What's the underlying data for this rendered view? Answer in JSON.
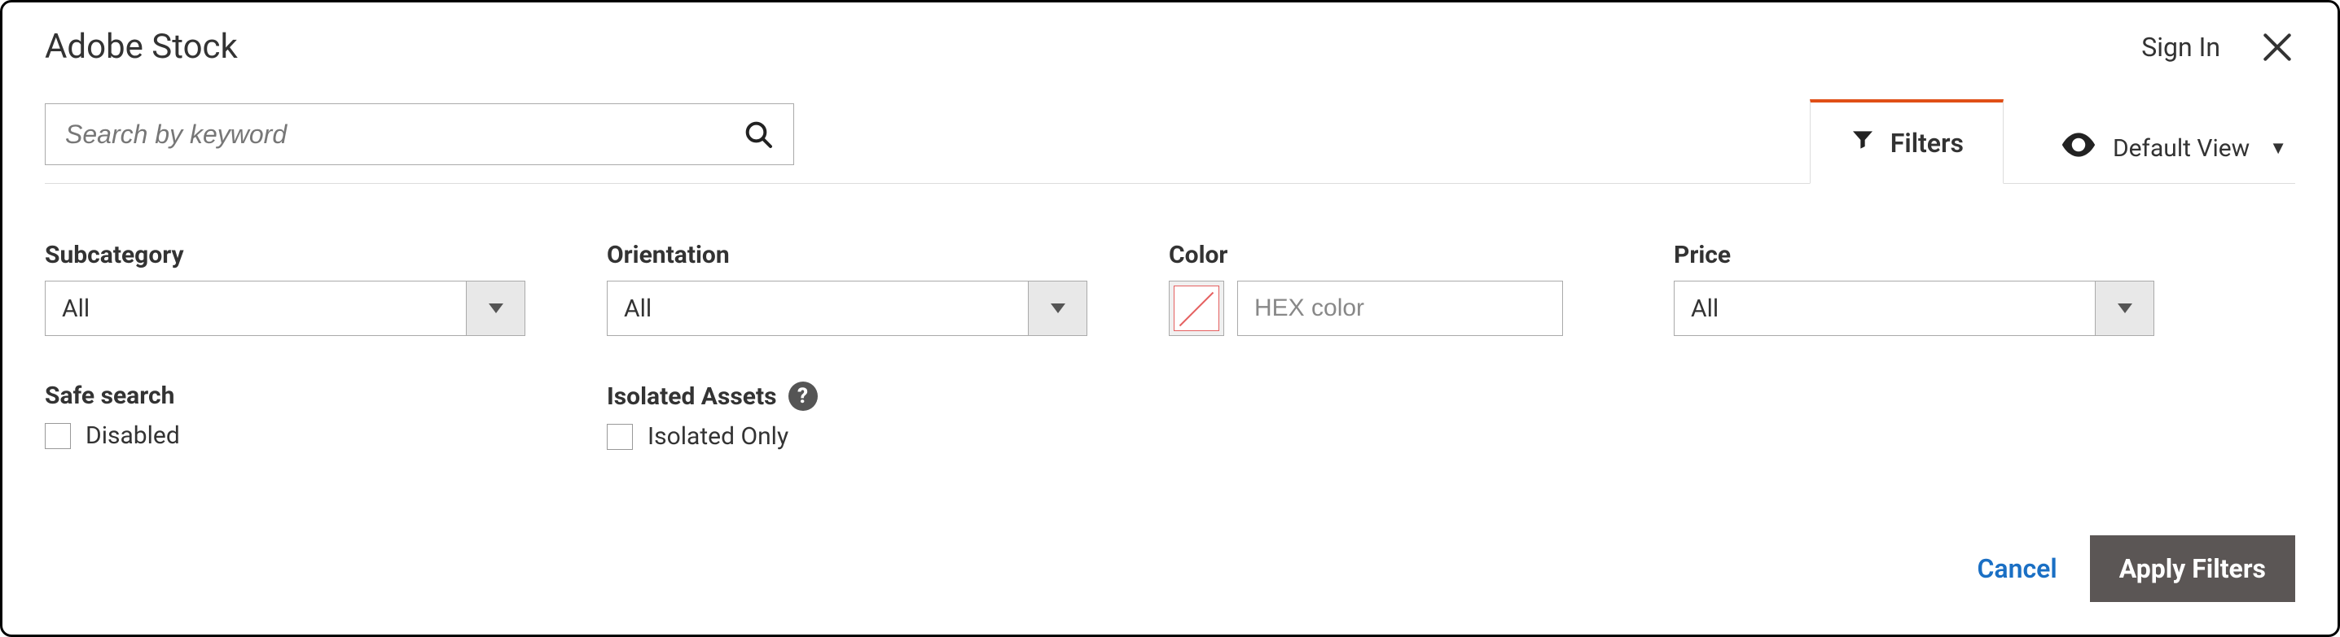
{
  "header": {
    "title": "Adobe Stock",
    "signin": "Sign In"
  },
  "toolbar": {
    "search_placeholder": "Search by keyword",
    "filters_tab": "Filters",
    "default_view": "Default View"
  },
  "filters": {
    "subcategory": {
      "label": "Subcategory",
      "value": "All"
    },
    "orientation": {
      "label": "Orientation",
      "value": "All"
    },
    "color": {
      "label": "Color",
      "hex_placeholder": "HEX color"
    },
    "price": {
      "label": "Price",
      "value": "All"
    },
    "safesearch": {
      "label": "Safe search",
      "option": "Disabled"
    },
    "isolated": {
      "label": "Isolated Assets",
      "option": "Isolated Only"
    }
  },
  "actions": {
    "cancel": "Cancel",
    "apply": "Apply Filters"
  },
  "colors": {
    "accent": "#e04f16",
    "primary_bg": "#5b5655",
    "link": "#1a6fc4"
  }
}
